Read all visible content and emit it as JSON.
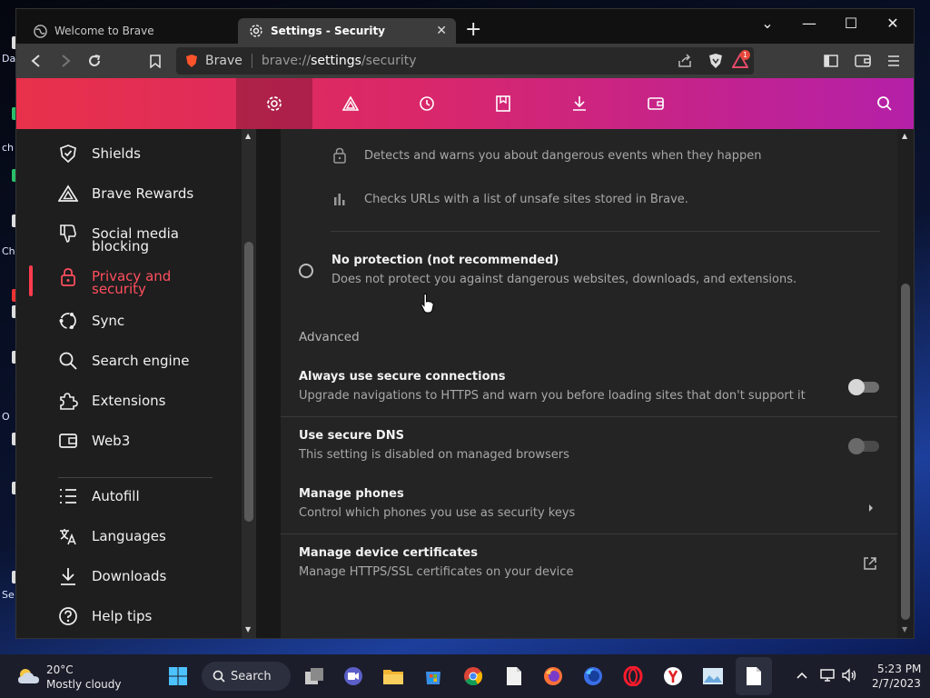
{
  "desktop": {
    "labels": [
      "Da",
      "ch",
      "Ch",
      "O",
      "Se"
    ]
  },
  "tabs": [
    {
      "title": "Welcome to Brave",
      "active": false,
      "icon": "globe-icon"
    },
    {
      "title": "Settings - Security",
      "active": true,
      "icon": "gear-icon"
    }
  ],
  "toolbar": {
    "url_brand": "Brave",
    "url_scheme": "brave://",
    "url_host": "settings",
    "url_path": "/security",
    "rewards_badge": "1"
  },
  "sidebar": {
    "items": [
      {
        "label": "Shields",
        "icon": "shield-icon"
      },
      {
        "label": "Brave Rewards",
        "icon": "brave-rewards-icon"
      },
      {
        "label": "Social media\nblocking",
        "icon": "thumbs-down-icon"
      },
      {
        "label": "Privacy and\nsecurity",
        "icon": "lock-icon",
        "active": true
      },
      {
        "label": "Sync",
        "icon": "sync-icon"
      },
      {
        "label": "Search engine",
        "icon": "search-icon"
      },
      {
        "label": "Extensions",
        "icon": "puzzle-icon"
      },
      {
        "label": "Web3",
        "icon": "wallet-icon"
      },
      {
        "label": "Autofill",
        "icon": "list-icon"
      },
      {
        "label": "Languages",
        "icon": "translate-icon"
      },
      {
        "label": "Downloads",
        "icon": "download-icon"
      },
      {
        "label": "Help tips",
        "icon": "help-icon"
      }
    ]
  },
  "content": {
    "detect_text": "Detects and warns you about dangerous events when they happen",
    "checks_text": "Checks URLs with a list of unsafe sites stored in Brave.",
    "no_protection_title": "No protection (not recommended)",
    "no_protection_desc": "Does not protect you against dangerous websites, downloads, and extensions.",
    "advanced_label": "Advanced",
    "secure_conn_title": "Always use secure connections",
    "secure_conn_desc": "Upgrade navigations to HTTPS and warn you before loading sites that don't support it",
    "secure_dns_title": "Use secure DNS",
    "secure_dns_desc": "This setting is disabled on managed browsers",
    "phones_title": "Manage phones",
    "phones_desc": "Control which phones you use as security keys",
    "certs_title": "Manage device certificates",
    "certs_desc": "Manage HTTPS/SSL certificates on your device"
  },
  "taskbar": {
    "weather_temp": "20°C",
    "weather_desc": "Mostly cloudy",
    "search_label": "Search",
    "time": "5:23 PM",
    "date": "2/7/2023"
  },
  "colors": {
    "brand_start": "#e8314a",
    "brand_end": "#b420a8",
    "active_nav": "#ff4f5e"
  }
}
